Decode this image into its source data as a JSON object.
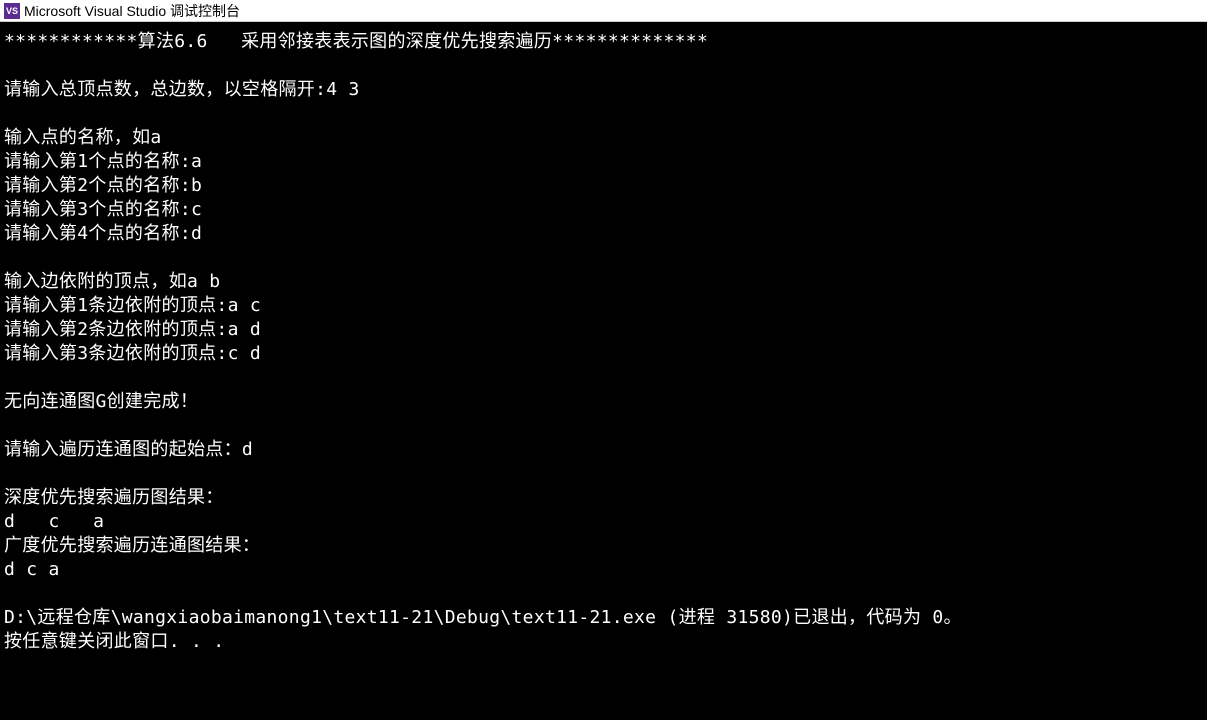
{
  "titlebar": {
    "icon_label": "VS",
    "title": "Microsoft Visual Studio 调试控制台"
  },
  "console": {
    "lines": [
      "************算法6.6   采用邻接表表示图的深度优先搜索遍历**************",
      "",
      "请输入总顶点数，总边数，以空格隔开:4 3",
      "",
      "输入点的名称，如a",
      "请输入第1个点的名称:a",
      "请输入第2个点的名称:b",
      "请输入第3个点的名称:c",
      "请输入第4个点的名称:d",
      "",
      "输入边依附的顶点，如a b",
      "请输入第1条边依附的顶点:a c",
      "请输入第2条边依附的顶点:a d",
      "请输入第3条边依附的顶点:c d",
      "",
      "无向连通图G创建完成！",
      "",
      "请输入遍历连通图的起始点：d",
      "",
      "深度优先搜索遍历图结果：",
      "d   c   a",
      "广度优先搜索遍历连通图结果：",
      "d c a",
      "",
      "D:\\远程仓库\\wangxiaobaimanong1\\text11-21\\Debug\\text11-21.exe (进程 31580)已退出，代码为 0。",
      "按任意键关闭此窗口. . ."
    ]
  }
}
